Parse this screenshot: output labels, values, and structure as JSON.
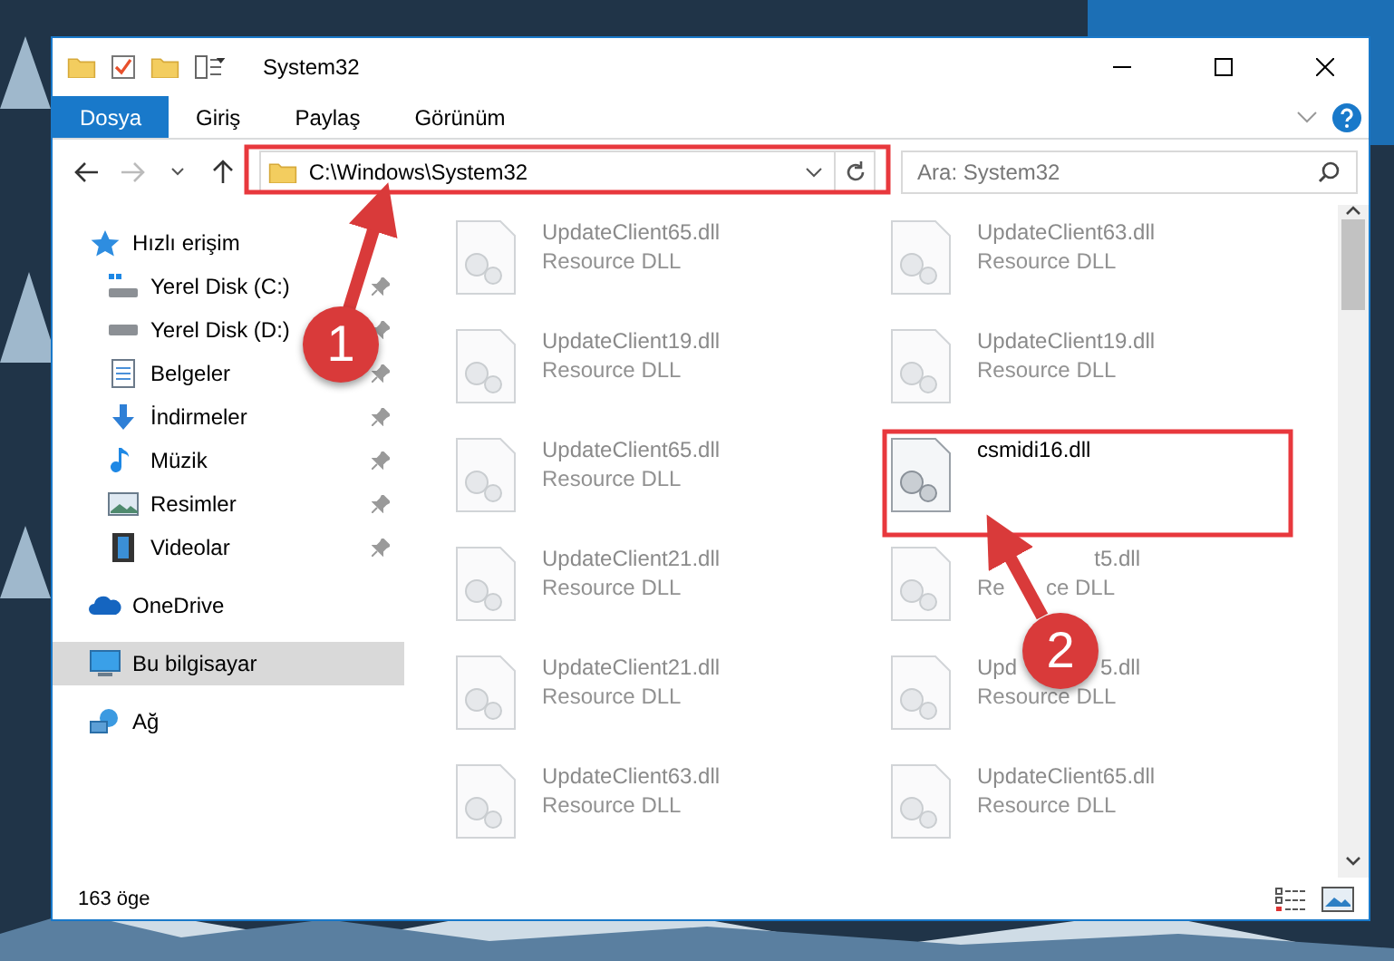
{
  "window": {
    "title": "System32"
  },
  "ribbon": {
    "tabs": [
      {
        "label": "Dosya",
        "selected": true
      },
      {
        "label": "Giriş",
        "selected": false
      },
      {
        "label": "Paylaş",
        "selected": false
      },
      {
        "label": "Görünüm",
        "selected": false
      }
    ]
  },
  "address": {
    "path": "C:\\Windows\\System32"
  },
  "search": {
    "placeholder": "Ara: System32"
  },
  "sidebar": {
    "items": [
      {
        "label": "Hızlı erişim",
        "kind": "star",
        "selected": false,
        "children": [
          {
            "label": "Yerel Disk (C:)",
            "kind": "system-drive",
            "pinned": true
          },
          {
            "label": "Yerel Disk (D:)",
            "kind": "drive",
            "pinned": true
          },
          {
            "label": "Belgeler",
            "kind": "documents",
            "pinned": true
          },
          {
            "label": "İndirmeler",
            "kind": "downloads",
            "pinned": true
          },
          {
            "label": "Müzik",
            "kind": "music",
            "pinned": true
          },
          {
            "label": "Resimler",
            "kind": "pictures",
            "pinned": true
          },
          {
            "label": "Videolar",
            "kind": "videos",
            "pinned": true
          }
        ]
      },
      {
        "label": "OneDrive",
        "kind": "cloud",
        "selected": false
      },
      {
        "label": "Bu bilgisayar",
        "kind": "computer",
        "selected": true
      },
      {
        "label": "Ağ",
        "kind": "network",
        "selected": false
      }
    ]
  },
  "files": [
    {
      "name": "UpdateClient65.dll",
      "type": "Resource DLL",
      "highlighted": false
    },
    {
      "name": "UpdateClient63.dll",
      "type": "Resource DLL",
      "highlighted": false
    },
    {
      "name": "UpdateClient19.dll",
      "type": "Resource DLL",
      "highlighted": false
    },
    {
      "name": "UpdateClient19.dll",
      "type": "Resource DLL",
      "highlighted": false
    },
    {
      "name": "UpdateClient65.dll",
      "type": "Resource DLL",
      "highlighted": false
    },
    {
      "name": "csmidi16.dll",
      "highlighted": true
    },
    {
      "name": "UpdateClient21.dll",
      "type": "Resource DLL",
      "highlighted": false
    },
    {
      "name_parts": [
        "t5.dll"
      ],
      "type_parts": [
        "Re",
        "ce DLL"
      ],
      "highlighted": false
    },
    {
      "name": "UpdateClient21.dll",
      "type": "Resource DLL",
      "highlighted": false
    },
    {
      "name_parts": [
        "Upd",
        "5.dll"
      ],
      "type": "Resource DLL",
      "highlighted": false
    },
    {
      "name": "UpdateClient63.dll",
      "type": "Resource DLL",
      "highlighted": false
    },
    {
      "name": "UpdateClient65.dll",
      "type": "Resource DLL",
      "highlighted": false
    }
  ],
  "status_bar": {
    "count": "163 öge"
  },
  "annotations": [
    {
      "number": "1"
    },
    {
      "number": "2"
    }
  ]
}
